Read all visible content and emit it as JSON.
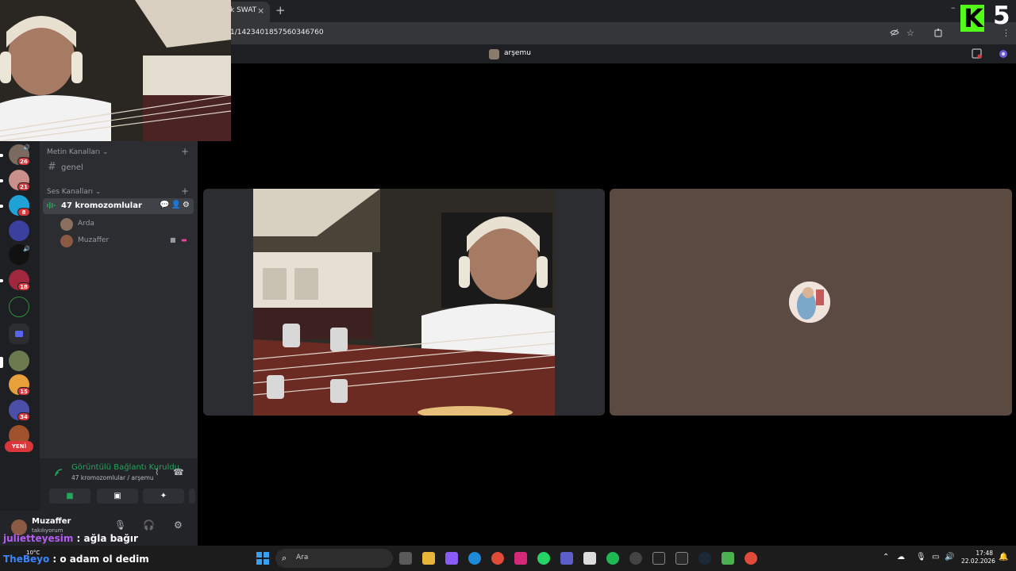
{
  "browser": {
    "tab_title": "k SWAT",
    "tab_close": "×",
    "new_tab": "+",
    "url": "1/1423401857560346760",
    "minimize": "–",
    "icons": [
      "eye-off-icon",
      "star-icon",
      "extensions-icon",
      "profile-icon",
      "menu-icon"
    ]
  },
  "kick_logo": {
    "letter": "K",
    "number": "5",
    "color": "#53fc18"
  },
  "app": {
    "server_name": "arşemu"
  },
  "server_rail": {
    "badges": [
      "26",
      "21",
      "8",
      "18",
      "15",
      "34"
    ],
    "new_label": "YENİ"
  },
  "channels": {
    "text_category": "Metin Kanalları",
    "text_channels": [
      {
        "name": "genel"
      }
    ],
    "voice_category": "Ses Kanalları",
    "voice_channel": "47 kromozomlular",
    "members": [
      {
        "name": "Arda"
      },
      {
        "name": "Muzaffer"
      }
    ]
  },
  "voice_panel": {
    "status": "Görüntülü Bağlantı Kuruldu",
    "channel_path": "47 kromozomlular / arşemu"
  },
  "user_panel": {
    "name": "Muzaffer",
    "status": "takılıyorum"
  },
  "chat": [
    {
      "user": "julietteyesim",
      "separator": " : ",
      "message": "ağla bağır"
    },
    {
      "user": "TheBeyo",
      "separator": " : ",
      "message": "o adam ol dedim"
    }
  ],
  "taskbar": {
    "weather": "10°C",
    "search_placeholder": "Ara",
    "time": "17:48",
    "date": "22.02.2026"
  },
  "colors": {
    "accent_green": "#23a55a",
    "badge_red": "#da373c",
    "chat_user_purple": "#b65cf6",
    "chat_user_blue": "#3a86ff"
  }
}
